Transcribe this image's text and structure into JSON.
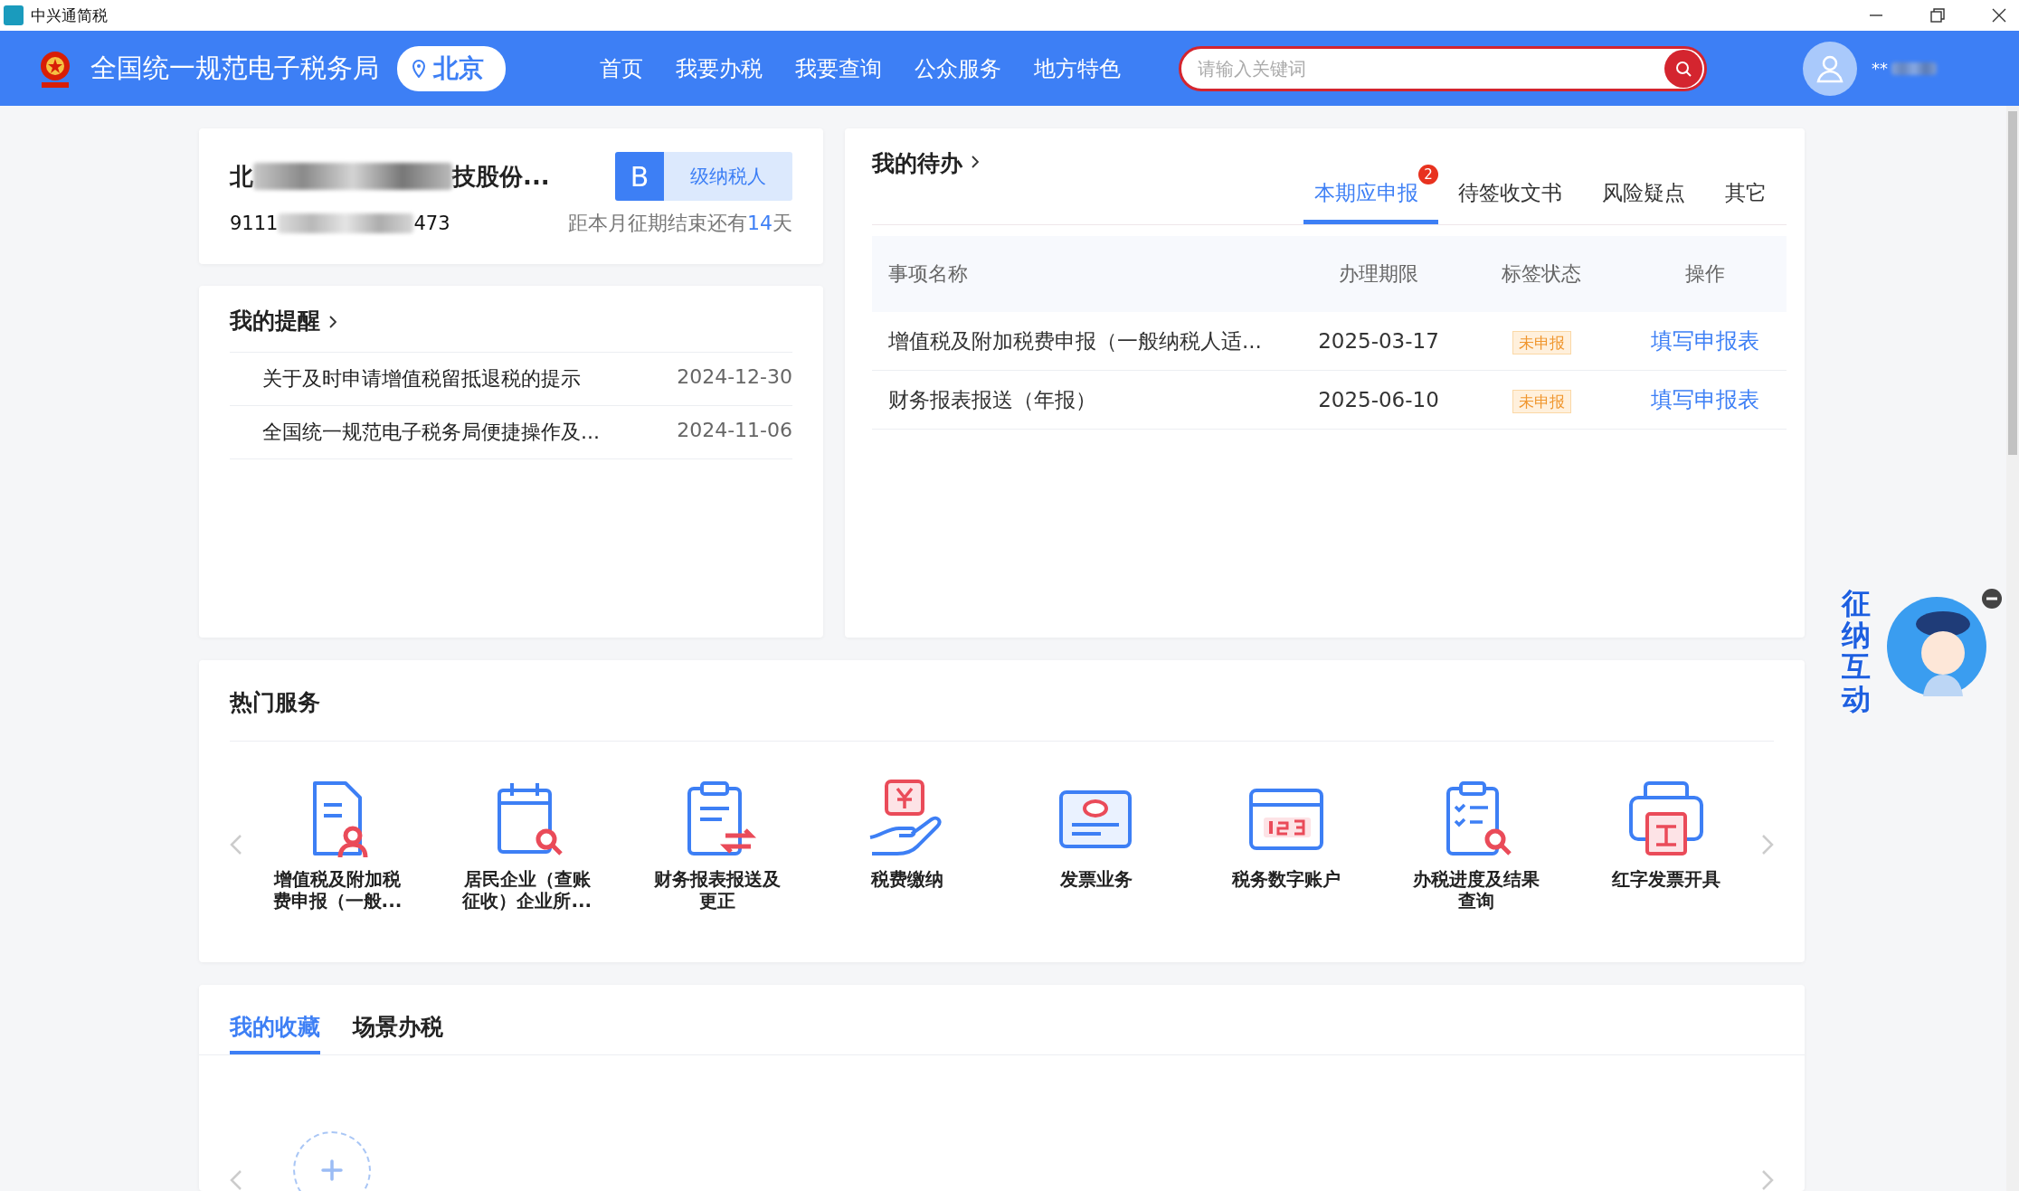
{
  "window": {
    "title": "中兴通简税"
  },
  "header": {
    "site_title": "全国统一规范电子税务局",
    "location": "北京",
    "nav": [
      {
        "label": "首页"
      },
      {
        "label": "我要办税"
      },
      {
        "label": "我要查询"
      },
      {
        "label": "公众服务"
      },
      {
        "label": "地方特色"
      }
    ],
    "search": {
      "placeholder": "请输入关键词"
    },
    "user": {
      "name": "**"
    }
  },
  "taxpayer": {
    "name_start": "北",
    "name_end": "技股份...",
    "id_start": "9111",
    "id_end": "473",
    "grade": "B",
    "grade_label": "级纳税人",
    "deadline_before": "距本月征期结束还有",
    "days": "14",
    "deadline_after": "天"
  },
  "reminders": {
    "title": "我的提醒",
    "items": [
      {
        "text": "关于及时申请增值税留抵退税的提示",
        "date": "2024-12-30"
      },
      {
        "text": "全国统一规范电子税务局便捷操作及...",
        "date": "2024-11-06"
      }
    ]
  },
  "todo": {
    "title": "我的待办",
    "tabs": [
      {
        "label": "本期应申报",
        "selected": true,
        "badge": "2"
      },
      {
        "label": "待签收文书",
        "selected": false
      },
      {
        "label": "风险疑点",
        "selected": false
      },
      {
        "label": "其它",
        "selected": false
      }
    ],
    "columns": [
      "事项名称",
      "办理期限",
      "标签状态",
      "操作"
    ],
    "rows": [
      {
        "name": "增值税及附加税费申报（一般纳税人适...",
        "deadline": "2025-03-17",
        "status": "未申报",
        "action": "填写申报表"
      },
      {
        "name": "财务报表报送（年报）",
        "deadline": "2025-06-10",
        "status": "未申报",
        "action": "填写申报表"
      }
    ]
  },
  "hot_services": {
    "title": "热门服务",
    "items": [
      {
        "label": "增值税及附加税费申报（一般..."
      },
      {
        "label": "居民企业（查账征收）企业所..."
      },
      {
        "label": "财务报表报送及更正"
      },
      {
        "label": "税费缴纳"
      },
      {
        "label": "发票业务"
      },
      {
        "label": "税务数字账户"
      },
      {
        "label": "办税进度及结果查询"
      },
      {
        "label": "红字发票开具"
      }
    ]
  },
  "favorites": {
    "tabs": [
      {
        "label": "我的收藏",
        "selected": true
      },
      {
        "label": "场景办税",
        "selected": false
      }
    ]
  },
  "assistant": {
    "label": "征纳互动"
  }
}
